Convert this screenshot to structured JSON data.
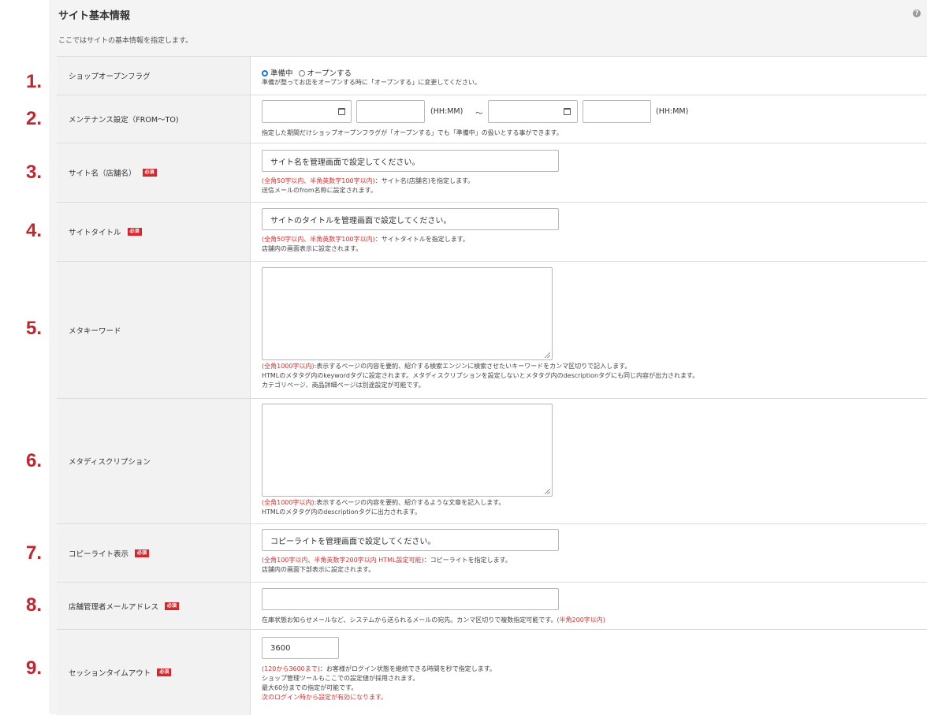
{
  "page": {
    "title": "サイト基本情報",
    "help_icon": "?",
    "description": "ここではサイトの基本情報を指定します。"
  },
  "required_badge": "必須",
  "numbers": [
    "1.",
    "2.",
    "3.",
    "4.",
    "5.",
    "6.",
    "7.",
    "8.",
    "9."
  ],
  "rows": {
    "shop_open": {
      "label": "ショップオープンフラグ",
      "options": [
        "準備中",
        "オープンする"
      ],
      "selected": "準備中",
      "note": "準備が整ってお店をオープンする時に「オープンする」に変更してください。"
    },
    "maintenance": {
      "label": "メンテナンス設定（FROM〜TO)",
      "time_unit": "(HH:MM)",
      "separator": "〜",
      "note": "指定した期間だけショップオープンフラグが「オープンする」でも「準備中」の扱いとする事ができます。"
    },
    "site_name": {
      "label": "サイト名（店舗名）",
      "value": "サイト名を管理画面で設定してください。",
      "note_red": "(全角50字以内、半角英数字100字以内)",
      "note": "：サイト名(店舗名)を指定します。",
      "note2": "送信メールのfrom名称に設定されます。"
    },
    "site_title": {
      "label": "サイトタイトル",
      "value": "サイトのタイトルを管理画面で設定してください。",
      "note_red": "(全角50字以内、半角英数字100字以内)",
      "note": "：サイトタイトルを指定します。",
      "note2": "店舗内の画面表示に設定されます。"
    },
    "meta_keyword": {
      "label": "メタキーワード",
      "value": "",
      "note_red": "(全角1000字以内)",
      "note": ":表示するページの内容を要約、紹介する検索エンジンに検索させたいキーワードをカンマ区切りで記入します。",
      "note2": "HTMLのメタタグ内のkeywordタグに設定されます。メタディスクリプションを設定しないとメタタグ内のdescriptionタグにも同じ内容が出力されます。",
      "note3": "カテゴリページ、商品詳細ページは別途設定が可能です。"
    },
    "meta_description": {
      "label": "メタディスクリプション",
      "value": "",
      "note_red": "(全角1000字以内)",
      "note": ":表示するページの内容を要約、紹介するような文章を記入します。",
      "note2": "HTMLのメタタグ内のdescriptionタグに出力されます。"
    },
    "copyright": {
      "label": "コピーライト表示",
      "value": "コピーライトを管理画面で設定してください。",
      "note_red": "(全角100字以内、半角英数字200字以内 HTML設定可能)",
      "note": "：コピーライトを指定します。",
      "note2": "店舗内の画面下部表示に設定されます。"
    },
    "admin_email": {
      "label": "店舗管理者メールアドレス",
      "value": "",
      "note": "在庫状態お知らせメールなど、システムから送られるメールの宛先。カンマ区切りで複数指定可能です。",
      "note_red": "(半角200字以内)"
    },
    "session_timeout": {
      "label": "セッションタイムアウト",
      "value": "3600",
      "note_red": "(120から3600まで)",
      "note": "：お客様がログイン状態を継続できる時間を秒で指定します。",
      "note2": "ショップ管理ツールもここでの設定値が採用されます。",
      "note3": "最大60分までの指定が可能です。",
      "note4_red": "次のログイン時から設定が有効になります。"
    }
  }
}
